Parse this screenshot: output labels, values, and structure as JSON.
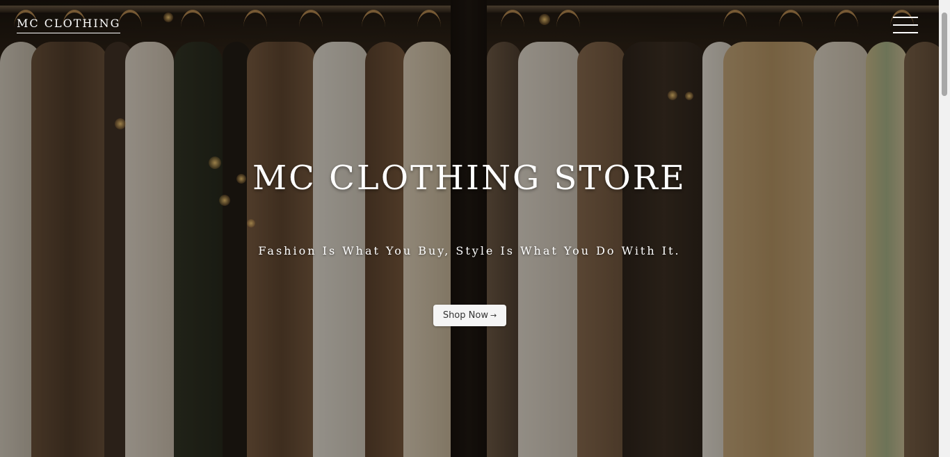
{
  "navbar": {
    "brand": "MC CLOTHING",
    "menu_icon": "hamburger-menu-icon"
  },
  "hero": {
    "title": "MC CLOTHING STORE",
    "tagline": "Fashion Is What You Buy, Style Is What You Do With It.",
    "cta_label": "Shop Now",
    "cta_icon": "arrow-right-icon",
    "cta_arrow": "→",
    "background_image": "clothing-rack-photo"
  },
  "colors": {
    "text": "#ffffff",
    "button_bg": "#f5f5f5",
    "button_text": "#333333"
  }
}
